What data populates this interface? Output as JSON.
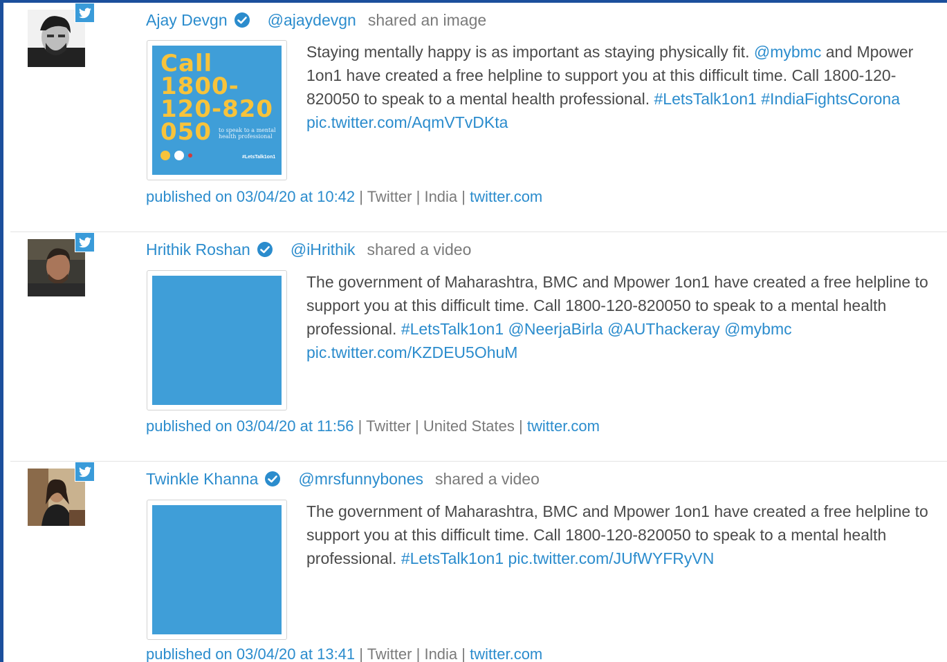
{
  "posts": [
    {
      "name": "Ajay Devgn",
      "handle": "@ajaydevgn",
      "action": "shared an image",
      "body": [
        {
          "t": "Staying mentally happy is as important as staying physically fit. "
        },
        {
          "t": "@mybmc",
          "link": true
        },
        {
          "t": " and Mpower 1on1 have created a free helpline to support you at this difficult time. Call 1800-120-820050 to speak to a mental health professional. "
        },
        {
          "t": "#LetsTalk1on1",
          "link": true
        },
        {
          "t": " "
        },
        {
          "t": "#IndiaFightsCorona",
          "link": true
        },
        {
          "t": " "
        },
        {
          "t": "pic.twitter.com/AqmVTvDKta",
          "link": true
        }
      ],
      "published": "published on 03/04/20 at 10:42",
      "network": "Twitter",
      "country": "India",
      "source": "twitter.com",
      "image": {
        "headline": "Call\n1800-\n120-820\n050",
        "sub": "to speak to a mental\nhealth professional",
        "tag": "#LetsTalk1on1"
      }
    },
    {
      "name": "Hrithik Roshan",
      "handle": "@iHrithik",
      "action": "shared a video",
      "body": [
        {
          "t": "The government of Maharashtra, BMC and Mpower 1on1 have created a free helpline to support you at this difficult time. Call 1800-120-820050 to speak to a mental health professional. "
        },
        {
          "t": "#LetsTalk1on1",
          "link": true
        },
        {
          "t": " "
        },
        {
          "t": "@NeerjaBirla",
          "link": true
        },
        {
          "t": " "
        },
        {
          "t": "@AUThackeray",
          "link": true
        },
        {
          "t": " "
        },
        {
          "t": "@mybmc",
          "link": true
        },
        {
          "t": " "
        },
        {
          "t": "pic.twitter.com/KZDEU5OhuM",
          "link": true
        }
      ],
      "published": "published on 03/04/20 at 11:56",
      "network": "Twitter",
      "country": "United States",
      "source": "twitter.com"
    },
    {
      "name": "Twinkle Khanna",
      "handle": "@mrsfunnybones",
      "action": "shared a video",
      "body": [
        {
          "t": "The government of Maharashtra, BMC and Mpower 1on1 have created a free helpline to support you at this difficult time. Call 1800-120-820050 to speak to a mental health professional. "
        },
        {
          "t": "#LetsTalk1on1",
          "link": true
        },
        {
          "t": " "
        },
        {
          "t": "pic.twitter.com/JUfWYFRyVN",
          "link": true
        }
      ],
      "published": "published on 03/04/20 at 13:41",
      "network": "Twitter",
      "country": "India",
      "source": "twitter.com"
    }
  ],
  "separator": " | ",
  "colors": {
    "link": "#2b8ccd",
    "twitter_blue": "#3a9bd9",
    "thumb_blue": "#3f9ed8",
    "frame": "#1b4f9c"
  },
  "icons": {
    "badge": "twitter-bird-icon",
    "verified": "verified-check-icon"
  }
}
